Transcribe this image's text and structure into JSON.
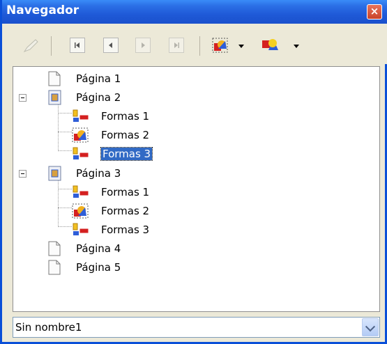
{
  "window": {
    "title": "Navegador"
  },
  "icons": {
    "pen": "pen-icon",
    "first": "first-page-icon",
    "previous": "previous-page-icon",
    "next": "next-page-icon",
    "last": "last-page-icon",
    "drag_mode": "drag-mode-icon",
    "shapes": "shapes-icon",
    "page": "page-icon",
    "shape_group": "shape-group-icon"
  },
  "tree": [
    {
      "label": "Página 1",
      "level": 0
    },
    {
      "label": "Página 2",
      "level": 0,
      "expanded": true
    },
    {
      "label": "Formas 1",
      "level": 1
    },
    {
      "label": "Formas 2",
      "level": 1
    },
    {
      "label": "Formas 3",
      "level": 1,
      "selected": true
    },
    {
      "label": "Página 3",
      "level": 0,
      "expanded": true
    },
    {
      "label": "Formas 1",
      "level": 1
    },
    {
      "label": "Formas 2",
      "level": 1
    },
    {
      "label": "Formas 3",
      "level": 1
    },
    {
      "label": "Página 4",
      "level": 0
    },
    {
      "label": "Página 5",
      "level": 0
    }
  ],
  "document_select": {
    "value": "Sin nombre1"
  },
  "colors": {
    "titlebar": "#2b6fe6",
    "selection": "#316ac5",
    "close": "#d4583a"
  }
}
